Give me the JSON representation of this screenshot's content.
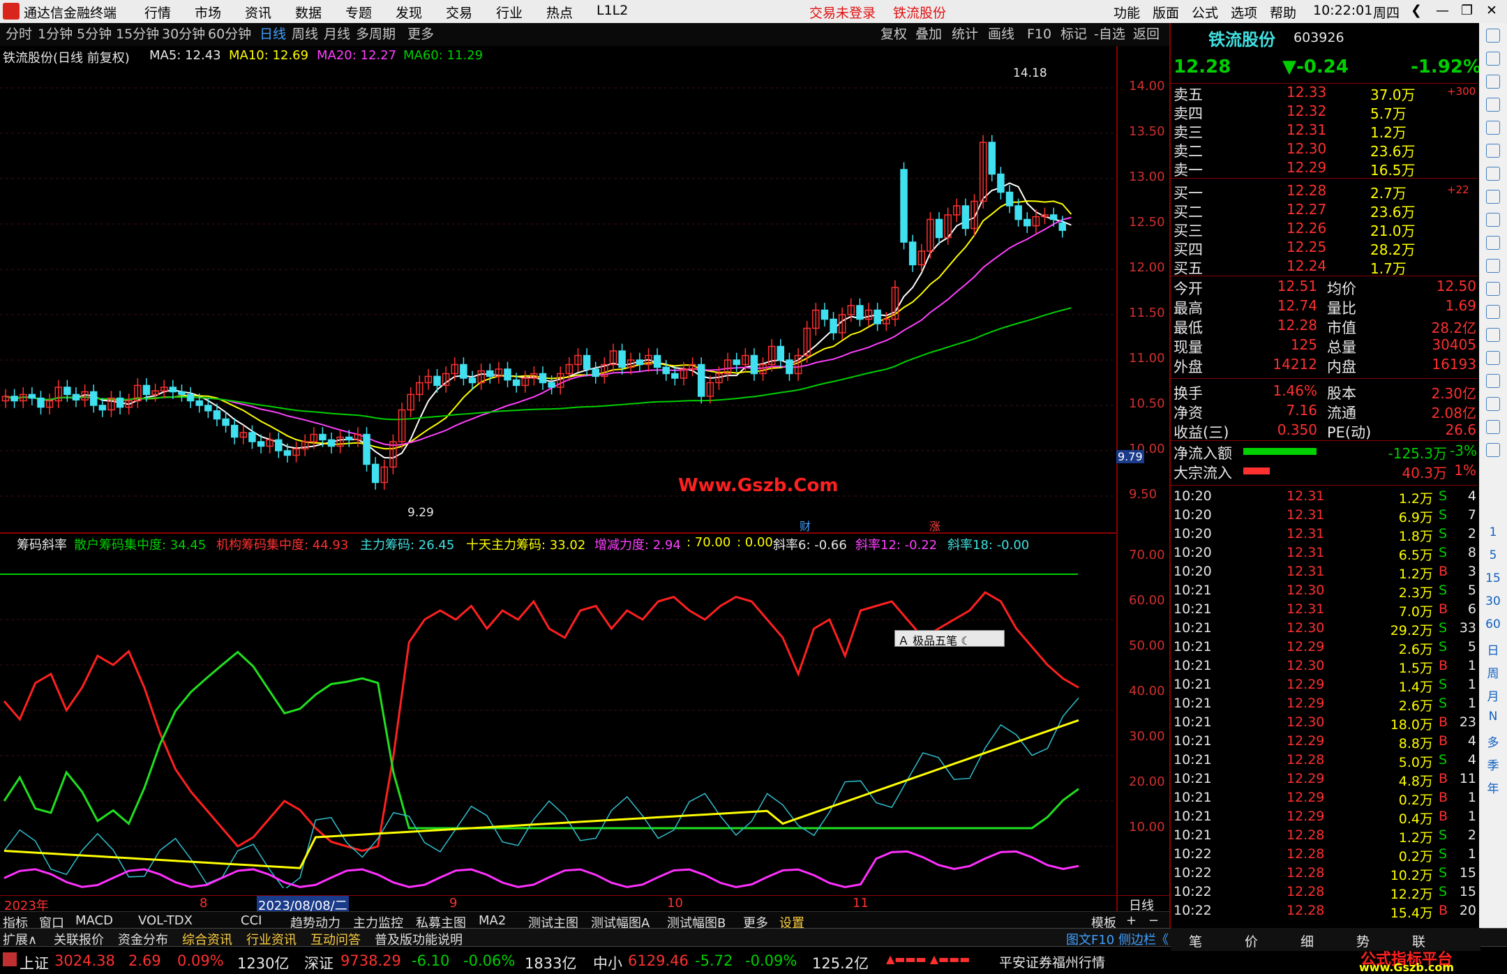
{
  "window": {
    "app_title": "通达信金融终端",
    "menus": [
      "行情",
      "市场",
      "资讯",
      "数据",
      "专题",
      "发现",
      "交易",
      "行业",
      "热点",
      "L1L2"
    ],
    "login": "交易未登录",
    "stock_link": "铁流股份",
    "right_menus": [
      "功能",
      "版面",
      "公式",
      "选项",
      "帮助"
    ],
    "clock": "10:22:01",
    "weekday": "周四"
  },
  "periods": [
    "分时",
    "1分钟",
    "5分钟",
    "15分钟",
    "30分钟",
    "60分钟",
    "日线",
    "周线",
    "月线",
    "多周期",
    "更多"
  ],
  "chart_tools": [
    "复权",
    "叠加",
    "统计",
    "画线",
    "F10",
    "标记",
    "-自选",
    "返回"
  ],
  "legend": {
    "name": "铁流股份(日线 前复权)",
    "ma5": "MA5: 12.43",
    "ma10": "MA10: 12.69",
    "ma20": "MA20: 12.27",
    "ma60": "MA60: 11.29"
  },
  "price_axis": [
    "14.00",
    "13.50",
    "13.00",
    "12.50",
    "12.00",
    "11.50",
    "11.00",
    "10.50",
    "10.00",
    "9.50"
  ],
  "price_marker": "9.79",
  "high_label": "14.18",
  "low_label": "9.29",
  "watermark": "Www.Gszb.Com",
  "flag_cai": "财",
  "flag_zhang": "涨",
  "ind_legend": {
    "name": "筹码斜率",
    "items": [
      "散户筹码集中度: 34.45",
      "机构筹码集中度: 44.93",
      "主力筹码: 26.45",
      "十天主力筹码: 33.02",
      "增减力度: 2.94",
      ": 70.00",
      ": 0.00",
      "斜率6: -0.66",
      "斜率12: -0.22",
      "斜率18: -0.00"
    ]
  },
  "ind_axis": [
    "70.00",
    "60.00",
    "50.00",
    "40.00",
    "30.00",
    "20.00",
    "10.00"
  ],
  "popup": "极品五笔",
  "date_axis": {
    "year": "2023年",
    "m8": "8",
    "cursor": "2023/08/08/二",
    "m9": "9",
    "m10": "10",
    "m11": "11",
    "period": "日线"
  },
  "ind_tabs": [
    "指标",
    "窗口",
    "MACD",
    "VOL-TDX",
    "CCI",
    "趋势动力",
    "主力监控",
    "私募主图",
    "MA2",
    "测试主图",
    "测试幅图A",
    "测试幅图B",
    "更多",
    "设置"
  ],
  "template_label": "模板",
  "sub_tabs": [
    "扩展∧",
    "关联报价",
    "资金分布",
    "综合资讯",
    "行业资讯",
    "互动问答",
    "普及版功能说明"
  ],
  "side_tail": "图文F10 侧边栏《",
  "quote": {
    "name": "铁流股份",
    "code": "603926",
    "price": "12.28",
    "change": "▼-0.24",
    "pct": "-1.92%",
    "asks": [
      [
        "卖五",
        "12.33",
        "37.0万",
        "+300"
      ],
      [
        "卖四",
        "12.32",
        "5.7万",
        ""
      ],
      [
        "卖三",
        "12.31",
        "1.2万",
        ""
      ],
      [
        "卖二",
        "12.30",
        "23.6万",
        ""
      ],
      [
        "卖一",
        "12.29",
        "16.5万",
        ""
      ]
    ],
    "bids": [
      [
        "买一",
        "12.28",
        "2.7万",
        "+22"
      ],
      [
        "买二",
        "12.27",
        "23.6万",
        ""
      ],
      [
        "买三",
        "12.26",
        "21.0万",
        ""
      ],
      [
        "买四",
        "12.25",
        "28.2万",
        ""
      ],
      [
        "买五",
        "12.24",
        "1.7万",
        ""
      ]
    ],
    "stats": [
      [
        "今开",
        "12.51",
        "均价",
        "12.50"
      ],
      [
        "最高",
        "12.74",
        "量比",
        "1.69"
      ],
      [
        "最低",
        "12.28",
        "市值",
        "28.2亿"
      ],
      [
        "现量",
        "125",
        "总量",
        "30405"
      ],
      [
        "外盘",
        "14212",
        "内盘",
        "16193"
      ]
    ],
    "stats2": [
      [
        "换手",
        "1.46%",
        "股本",
        "2.30亿"
      ],
      [
        "净资",
        "7.16",
        "流通",
        "2.08亿"
      ],
      [
        "收益(三)",
        "0.350",
        "PE(动)",
        "26.6"
      ]
    ],
    "flow": [
      [
        "净流入额",
        "-125.3万",
        "-3%"
      ],
      [
        "大宗流入",
        "40.3万",
        "1%"
      ]
    ],
    "ticks": [
      [
        "10:20",
        "12.31",
        "1.2万",
        "S",
        "4"
      ],
      [
        "10:20",
        "12.31",
        "6.9万",
        "S",
        "7"
      ],
      [
        "10:20",
        "12.31",
        "1.8万",
        "S",
        "2"
      ],
      [
        "10:20",
        "12.31",
        "6.5万",
        "S",
        "8"
      ],
      [
        "10:20",
        "12.31",
        "1.2万",
        "B",
        "3"
      ],
      [
        "10:21",
        "12.30",
        "2.3万",
        "S",
        "5"
      ],
      [
        "10:21",
        "12.31",
        "7.0万",
        "B",
        "6"
      ],
      [
        "10:21",
        "12.30",
        "29.2万",
        "S",
        "33"
      ],
      [
        "10:21",
        "12.29",
        "2.6万",
        "S",
        "5"
      ],
      [
        "10:21",
        "12.30",
        "1.5万",
        "B",
        "1"
      ],
      [
        "10:21",
        "12.29",
        "1.4万",
        "S",
        "1"
      ],
      [
        "10:21",
        "12.29",
        "2.6万",
        "S",
        "1"
      ],
      [
        "10:21",
        "12.30",
        "18.0万",
        "B",
        "23"
      ],
      [
        "10:21",
        "12.29",
        "8.8万",
        "B",
        "4"
      ],
      [
        "10:21",
        "12.28",
        "5.0万",
        "S",
        "4"
      ],
      [
        "10:21",
        "12.29",
        "4.8万",
        "B",
        "11"
      ],
      [
        "10:21",
        "12.29",
        "0.2万",
        "B",
        "1"
      ],
      [
        "10:21",
        "12.29",
        "0.4万",
        "B",
        "1"
      ],
      [
        "10:21",
        "12.28",
        "1.2万",
        "S",
        "2"
      ],
      [
        "10:22",
        "12.28",
        "0.2万",
        "S",
        "1"
      ],
      [
        "10:22",
        "12.28",
        "10.2万",
        "S",
        "15"
      ],
      [
        "10:22",
        "12.28",
        "12.2万",
        "S",
        "15"
      ],
      [
        "10:22",
        "12.28",
        "15.4万",
        "B",
        "20"
      ]
    ],
    "tabs": [
      "笔",
      "价",
      "细",
      "势",
      "联"
    ]
  },
  "side_tools": [
    "1",
    "5",
    "15",
    "30",
    "60",
    "日",
    "周",
    "月",
    "N",
    "多",
    "季",
    "年"
  ],
  "status": {
    "sh": "上证",
    "sh_v": "3024.38",
    "sh_c": "2.69",
    "sh_p": "0.09%",
    "sh_a": "1230亿",
    "sz": "深证",
    "sz_v": "9738.29",
    "sz_c": "-6.10",
    "sz_p": "-0.06%",
    "sz_a": "1833亿",
    "zx": "中小",
    "zx_v": "6129.46",
    "zx_c": "-5.72",
    "zx_p": "-0.09%",
    "zx_a": "125.2亿",
    "broker": "平安证券福州行情",
    "brand": "公式指标平台",
    "brand_url": "www.Gszb.com"
  },
  "chart_data": {
    "type": "candlestick",
    "close": [
      10.6,
      10.55,
      10.62,
      10.58,
      10.48,
      10.55,
      10.7,
      10.62,
      10.56,
      10.65,
      10.5,
      10.45,
      10.58,
      10.48,
      10.55,
      10.72,
      10.62,
      10.66,
      10.7,
      10.65,
      10.62,
      10.55,
      10.5,
      10.44,
      10.35,
      10.28,
      10.15,
      10.2,
      10.1,
      10.05,
      10.12,
      10.0,
      9.95,
      10.02,
      10.1,
      10.18,
      10.12,
      10.05,
      10.15,
      10.12,
      10.18,
      9.85,
      9.65,
      9.82,
      10.1,
      10.45,
      10.62,
      10.75,
      10.82,
      10.72,
      10.85,
      10.95,
      10.8,
      10.75,
      10.88,
      10.82,
      10.9,
      10.78,
      10.72,
      10.8,
      10.85,
      10.75,
      10.7,
      10.85,
      10.95,
      11.05,
      10.9,
      10.82,
      10.95,
      11.1,
      10.92,
      11.0,
      10.95,
      11.05,
      10.92,
      10.85,
      10.8,
      10.9,
      10.95,
      10.6,
      10.75,
      10.85,
      11.0,
      10.95,
      11.05,
      10.85,
      10.95,
      11.15,
      11.0,
      10.85,
      11.05,
      11.35,
      11.55,
      11.45,
      11.3,
      11.5,
      11.6,
      11.45,
      11.55,
      11.4,
      11.45,
      11.8,
      12.3,
      12.05,
      12.2,
      12.55,
      12.35,
      12.6,
      12.7,
      12.45,
      12.75,
      13.4,
      13.05,
      12.85,
      12.7,
      12.55,
      12.48,
      12.58,
      12.6,
      12.55,
      12.43,
      12.28
    ],
    "open": [
      10.55,
      10.6,
      10.55,
      10.62,
      10.58,
      10.48,
      10.55,
      10.7,
      10.62,
      10.56,
      10.65,
      10.5,
      10.45,
      10.58,
      10.48,
      10.55,
      10.72,
      10.62,
      10.66,
      10.7,
      10.65,
      10.62,
      10.55,
      10.5,
      10.44,
      10.35,
      10.28,
      10.15,
      10.2,
      10.1,
      10.05,
      10.12,
      10.0,
      9.95,
      10.02,
      10.1,
      10.18,
      10.12,
      10.05,
      10.15,
      10.12,
      10.18,
      9.85,
      9.65,
      9.82,
      10.1,
      10.45,
      10.62,
      10.75,
      10.82,
      10.72,
      10.85,
      10.95,
      10.8,
      10.75,
      10.88,
      10.82,
      10.9,
      10.78,
      10.72,
      10.8,
      10.85,
      10.75,
      10.7,
      10.85,
      10.95,
      11.05,
      10.9,
      10.82,
      10.95,
      11.1,
      10.92,
      11.0,
      10.95,
      11.05,
      10.92,
      10.85,
      10.8,
      10.9,
      10.95,
      10.6,
      10.75,
      10.85,
      11.0,
      10.95,
      11.05,
      10.85,
      10.95,
      11.15,
      11.0,
      10.85,
      11.05,
      11.35,
      11.55,
      11.45,
      11.3,
      11.5,
      11.6,
      11.45,
      11.55,
      11.4,
      11.45,
      13.1,
      12.3,
      12.05,
      12.2,
      12.55,
      12.35,
      12.6,
      12.7,
      12.45,
      12.75,
      13.4,
      13.05,
      12.85,
      12.7,
      12.55,
      12.48,
      12.58,
      12.6,
      12.51
    ],
    "ind_lines": {
      "red": [
        42,
        38,
        46,
        48,
        40,
        45,
        52,
        50,
        53,
        45,
        35,
        27,
        22,
        18,
        14,
        10,
        12,
        16,
        20,
        18,
        14,
        11,
        10,
        9,
        10,
        30,
        55,
        60,
        62,
        60,
        63,
        58,
        62,
        60,
        64,
        58,
        56,
        62,
        63,
        58,
        62,
        60,
        64,
        65,
        62,
        60,
        63,
        65,
        64,
        60,
        56,
        48,
        58,
        60,
        52,
        62,
        63,
        64,
        60,
        56,
        58,
        60,
        62,
        66,
        64,
        58,
        54,
        50,
        47,
        45
      ]
    }
  }
}
